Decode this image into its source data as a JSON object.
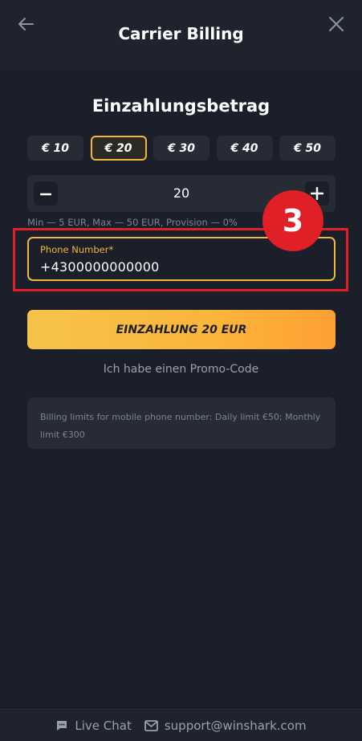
{
  "header": {
    "title": "Carrier Billing",
    "back_icon": "arrow-left-icon",
    "close_icon": "close-icon"
  },
  "deposit": {
    "title": "Einzahlungsbetrag",
    "amounts": [
      "€ 10",
      "€ 20",
      "€ 30",
      "€ 40",
      "€ 50"
    ],
    "selected_amount": "€ 20",
    "stepper_value": "20",
    "limits_text": "Min — 5 EUR, Max — 50 EUR, Provision — 0%"
  },
  "phone": {
    "label": "Phone Number*",
    "value": "+4300000000000"
  },
  "annotation": {
    "step_number": "3",
    "color": "#e01f26"
  },
  "actions": {
    "deposit_button": "EINZAHLUNG 20 EUR",
    "promo_link": "Ich habe einen Promo-Code"
  },
  "info": {
    "text": "Billing limits for mobile phone number: Daily limit €50; Monthly limit €300"
  },
  "footer": {
    "live_chat": "Live Chat",
    "support_email": "support@winshark.com"
  },
  "colors": {
    "accent": "#f2b63c",
    "background": "#1b1f29"
  }
}
